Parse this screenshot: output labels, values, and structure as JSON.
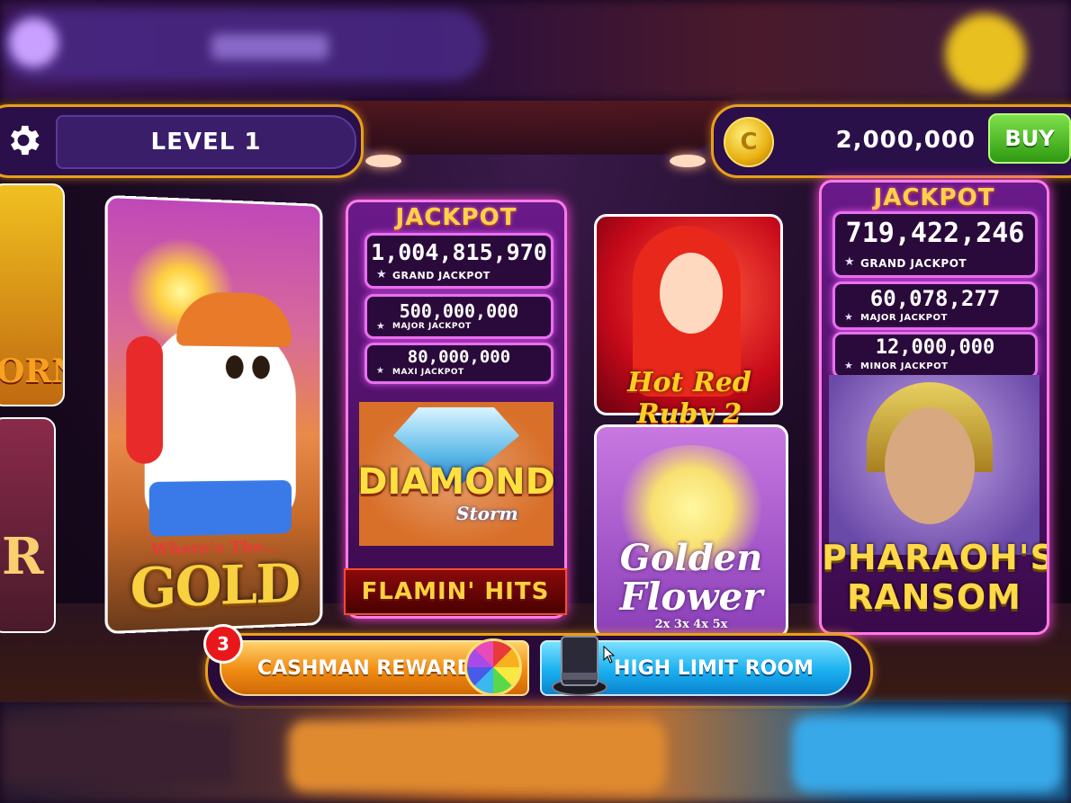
{
  "header": {
    "level_label": "LEVEL 1",
    "coins": "2,000,000",
    "buy_label": "BUY",
    "coin_symbol": "C"
  },
  "games": [
    {
      "name": "Where's The... GOLD",
      "subtitle": "Where's The...",
      "title": "GOLD"
    },
    {
      "name": "Diamond Storm",
      "jackpot_label": "JACKPOT",
      "jackpots": [
        {
          "value": "1,004,815,970",
          "label": "GRAND JACKPOT"
        },
        {
          "value": "500,000,000",
          "label": "MAJOR JACKPOT"
        },
        {
          "value": "80,000,000",
          "label": "MAXI JACKPOT"
        }
      ],
      "title": "DIAMOND",
      "subtitle": "Storm",
      "banner": "FLAMIN' HITS"
    },
    {
      "name": "Hot Red Ruby 2",
      "title": "Hot Red Ruby 2"
    },
    {
      "name": "Golden Flower",
      "title_line1": "Golden",
      "title_line2": "Flower",
      "multipliers": "2x 3x 4x 5x"
    },
    {
      "name": "Pharaoh's Ransom",
      "jackpot_label": "JACKPOT",
      "jackpots": [
        {
          "value": "719,422,246",
          "label": "GRAND JACKPOT"
        },
        {
          "value": "60,078,277",
          "label": "MAJOR JACKPOT"
        },
        {
          "value": "12,000,000",
          "label": "MINOR JACKPOT"
        }
      ],
      "title_line1": "PHARAOH'S",
      "title_line2": "RANSOM"
    }
  ],
  "edge_games": {
    "left_top_text": "ORN",
    "left_bottom_text": "R"
  },
  "footer": {
    "rewards_label": "CASHMAN REWARDS",
    "rewards_badge": "3",
    "high_limit_label": "HIGH LIMIT ROOM"
  },
  "colors": {
    "frame_gold": "#e8a018",
    "neon_pink": "#ff7ae8",
    "buy_green": "#2e9a12",
    "rewards_orange": "#f08a10",
    "high_limit_blue": "#1ab0f0"
  },
  "icons": [
    "gear-icon",
    "coin-icon",
    "prize-wheel-icon",
    "top-hat-icon",
    "cursor-icon"
  ]
}
